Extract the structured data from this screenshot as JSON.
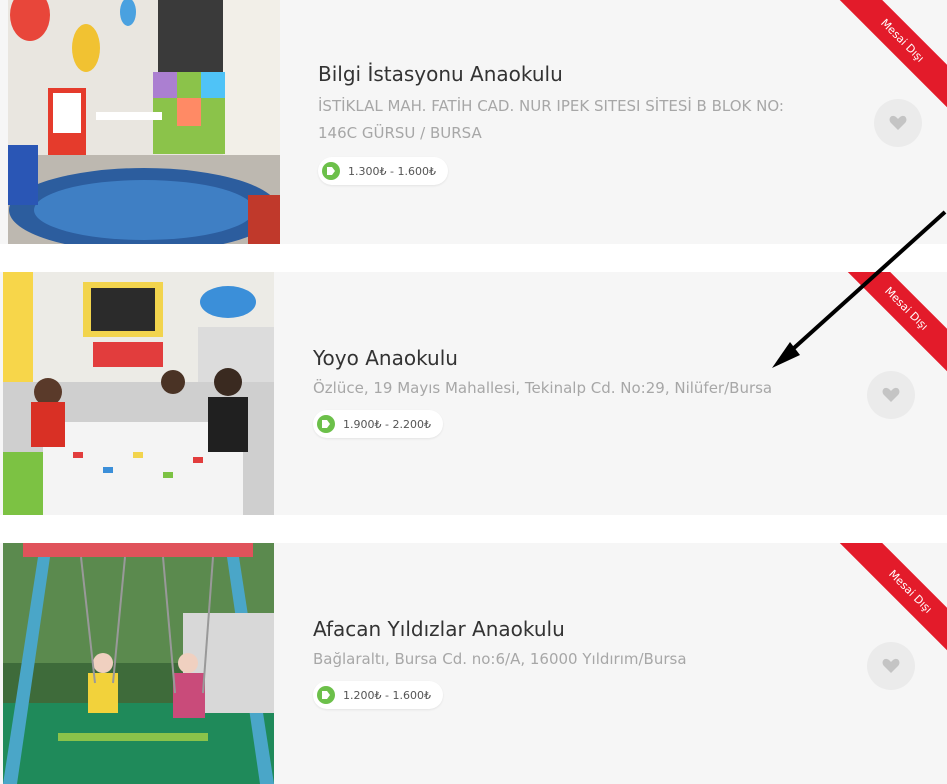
{
  "listings": [
    {
      "name": "Bilgi İstasyonu Anaokulu",
      "address": "İSTİKLAL MAH. FATİH CAD. NUR IPEK SITESI SİTESİ B BLOK NO: 146C GÜRSU / BURSA",
      "price": "1.300₺ - 1.600₺",
      "ribbon": "Mesai Dışı"
    },
    {
      "name": "Yoyo Anaokulu",
      "address": "Özlüce, 19 Mayıs Mahallesi, Tekinalp Cd. No:29, Nilüfer/Bursa",
      "price": "1.900₺ - 2.200₺",
      "ribbon": "Mesai Dışı"
    },
    {
      "name": "Afacan Yıldızlar Anaokulu",
      "address": "Bağlaraltı, Bursa Cd. no:6/A, 16000 Yıldırım/Bursa",
      "price": "1.200₺ - 1.600₺",
      "ribbon": "Mesai Dışı"
    }
  ],
  "icons": {
    "price": "price-tag-icon",
    "favorite": "heart-icon"
  },
  "colors": {
    "ribbon": "#e31b2a",
    "tag": "#6cc04a",
    "card_bg": "#f6f6f6",
    "arrow": "#000000"
  }
}
